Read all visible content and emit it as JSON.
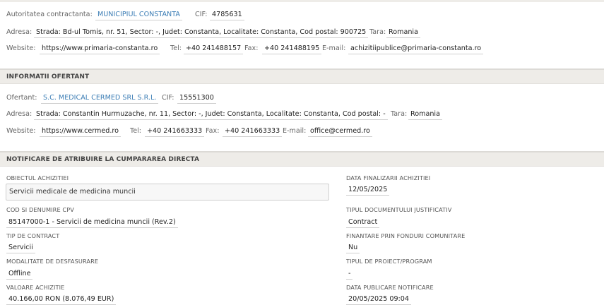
{
  "authority": {
    "label": "Autoritatea contractanta:",
    "name": "MUNICIPIUL CONSTANTA",
    "cif_label": "CIF:",
    "cif": "4785631",
    "address_label": "Adresa:",
    "address": "Strada: Bd-ul Tomis, nr. 51, Sector: -, Judet: Constanta, Localitate: Constanta, Cod postal: 900725",
    "country_label": "Tara:",
    "country": "Romania",
    "website_label": "Website:",
    "website": "https://www.primaria-constanta.ro",
    "tel_label": "Tel:",
    "tel": "+40 241488157",
    "fax_label": "Fax:",
    "fax": "+40 241488195",
    "email_label": "E-mail:",
    "email": "achizitiipublice@primaria-constanta.ro"
  },
  "bidder": {
    "section_title": "INFORMATII OFERTANT",
    "label": "Ofertant:",
    "name": "S.C. MEDICAL CERMED SRL S.R.L.",
    "cif_label": "CIF:",
    "cif": "15551300",
    "address_label": "Adresa:",
    "address": "Strada: Constantin Hurmuzache, nr. 11, Sector: -, Judet: Constanta, Localitate: Constanta, Cod postal: -",
    "country_label": "Tara:",
    "country": "Romania",
    "website_label": "Website:",
    "website": "https://www.cermed.ro",
    "tel_label": "Tel:",
    "tel": "+40 241663333",
    "fax_label": "Fax:",
    "fax": "+40 241663333",
    "email_label": "E-mail:",
    "email": "office@cermed.ro"
  },
  "notification": {
    "section_title": "NOTIFICARE DE ATRIBUIRE LA CUMPARAREA DIRECTA",
    "object_label": "OBIECTUL ACHIZITIEI",
    "object_value": "Servicii medicale de medicina muncii",
    "end_date_label": "DATA FINALIZARII ACHIZITIEI",
    "end_date": "12/05/2025",
    "cpv_label": "COD SI DENUMIRE CPV",
    "cpv_value": "85147000-1 - Servicii de medicina muncii (Rev.2)",
    "doc_type_label": "TIPUL DOCUMENTULUI JUSTIFICATIV",
    "doc_type": "Contract",
    "contract_type_label": "TIP DE CONTRACT",
    "contract_type": "Servicii",
    "eu_funds_label": "FINANTARE PRIN FONDURI COMUNITARE",
    "eu_funds": "Nu",
    "mode_label": "MODALITATE DE DESFASURARE",
    "mode": "Offline",
    "project_type_label": "TIPUL DE PROIECT/PROGRAM",
    "project_type": "-",
    "value_label": "VALOARE ACHIZITIE",
    "value": "40.166,00 RON (8.076,49 EUR)",
    "publish_date_label": "DATA PUBLICARE NOTIFICARE",
    "publish_date": "20/05/2025 09:04"
  }
}
